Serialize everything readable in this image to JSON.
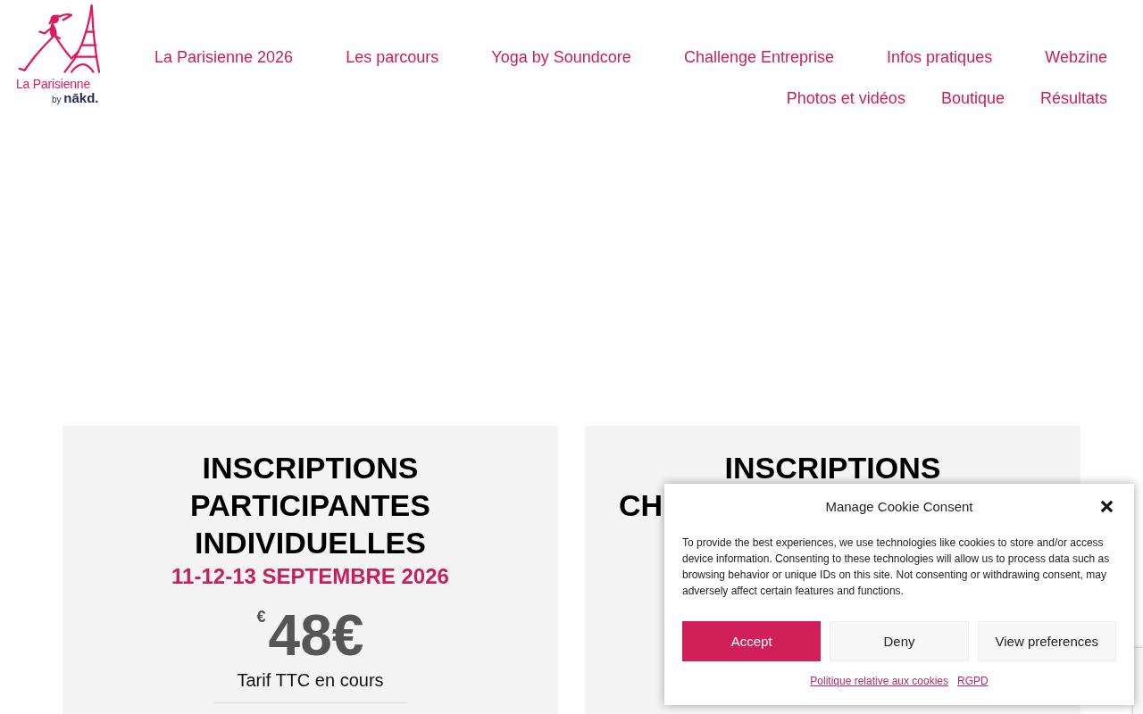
{
  "logo": {
    "name": "La Parisienne",
    "tagline": "by **nākd.**"
  },
  "nav": [
    {
      "label": "La Parisienne 2026"
    },
    {
      "label": "Les parcours"
    },
    {
      "label": "Yoga by Soundcore"
    },
    {
      "label": "Challenge Entreprise"
    },
    {
      "label": "Infos pratiques"
    },
    {
      "label": "Webzine"
    },
    {
      "label": "Photos et vidéos"
    },
    {
      "label": "Boutique"
    },
    {
      "label": "Résultats"
    }
  ],
  "cards": [
    {
      "title_lines": [
        "INSCRIPTIONS",
        "PARTICIPANTES",
        "INDIVIDUELLES"
      ],
      "date": "11-12-13 SEPTEMBRE 2026",
      "price": {
        "currency": "€",
        "amount": "48€"
      },
      "note": "Tarif TTC en cours"
    },
    {
      "title_lines": [
        "INSCRIPTIONS"
      ],
      "title_cut_line": "CH"
    }
  ],
  "cookie_dialog": {
    "title": "Manage Cookie Consent",
    "body": "To provide the best experiences, we use technologies like cookies to store and/or access device information. Consenting to these technologies will allow us to process data such as browsing behavior or unique IDs on this site. Not consenting or withdrawing consent, may adversely affect certain features and functions.",
    "buttons": [
      {
        "label": "Accept",
        "kind": "primary"
      },
      {
        "label": "Deny",
        "kind": "secondary"
      },
      {
        "label": "View preferences",
        "kind": "secondary"
      }
    ],
    "links": [
      "Politique relative aux cookies",
      "RGPD"
    ]
  }
}
